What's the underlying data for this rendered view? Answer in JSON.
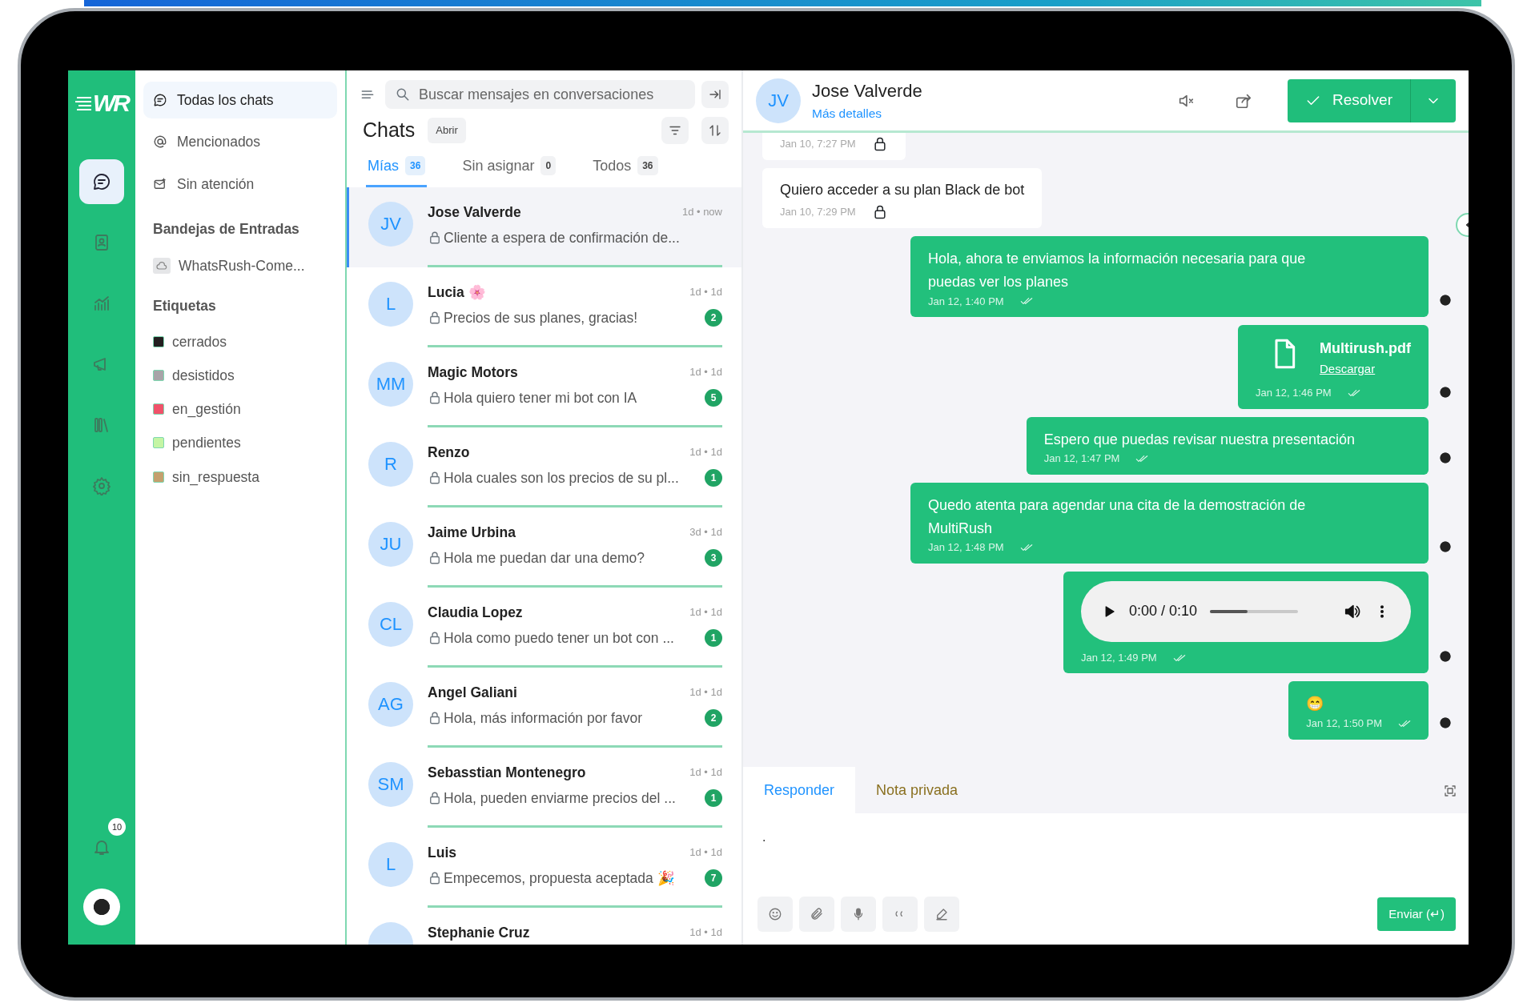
{
  "rail": {
    "logo_text": "WR",
    "items": [
      {
        "selected": true
      },
      {
        "selected": false
      },
      {
        "selected": false
      },
      {
        "selected": false
      },
      {
        "selected": false
      },
      {
        "selected": false
      }
    ],
    "notifications": "10"
  },
  "sidebar": {
    "nav": [
      {
        "label": "Todas los chats",
        "selected": true
      },
      {
        "label": "Mencionados",
        "selected": false
      },
      {
        "label": "Sin atención",
        "selected": false
      }
    ],
    "inboxes_title": "Bandejas de Entradas",
    "inboxes": [
      {
        "label": "WhatsRush-Come..."
      }
    ],
    "labels_title": "Etiquetas",
    "labels": [
      {
        "label": "cerrados",
        "color": "#231f20"
      },
      {
        "label": "desistidos",
        "color": "#a8a4a8"
      },
      {
        "label": "en_gestión",
        "color": "#f0526a"
      },
      {
        "label": "pendientes",
        "color": "#c4f5a4"
      },
      {
        "label": "sin_respuesta",
        "color": "#c4a06e"
      }
    ]
  },
  "chat_list": {
    "search": {
      "placeholder": "Buscar mensajes en conversaciones"
    },
    "title": "Chats",
    "status": "Abrir",
    "tabs": [
      {
        "label": "Mías",
        "count": "36",
        "selected": true
      },
      {
        "label": "Sin asignar",
        "count": "0",
        "selected": false
      },
      {
        "label": "Todos",
        "count": "36",
        "selected": false
      }
    ],
    "conversations": [
      {
        "initials": "JV",
        "name": "Jose Valverde",
        "time": "1d • now",
        "preview": "Cliente a espera de confirmación de...",
        "selected": true
      },
      {
        "initials": "L",
        "name": "Lucia 🌸",
        "time": "1d • 1d",
        "preview": "Precios de sus planes, gracias!",
        "unread": "2",
        "selected": false
      },
      {
        "initials": "MM",
        "name": "Magic Motors",
        "time": "1d • 1d",
        "preview": "Hola quiero tener mi bot con IA",
        "unread": "5",
        "selected": false
      },
      {
        "initials": "R",
        "name": "Renzo",
        "time": "1d • 1d",
        "preview": "Hola cuales son los precios de su pl...",
        "unread": "1",
        "selected": false
      },
      {
        "initials": "JU",
        "name": "Jaime Urbina",
        "time": "3d • 1d",
        "preview": "Hola me puedan dar una demo?",
        "unread": "3",
        "selected": false
      },
      {
        "initials": "CL",
        "name": "Claudia Lopez",
        "time": "1d • 1d",
        "preview": "Hola como puedo tener un bot con ...",
        "unread": "1",
        "selected": false
      },
      {
        "initials": "AG",
        "name": "Angel Galiani",
        "time": "1d • 1d",
        "preview": "Hola, más información por favor",
        "unread": "2",
        "selected": false
      },
      {
        "initials": "SM",
        "name": "Sebasstian Montenegro",
        "time": "1d • 1d",
        "preview": "Hola, pueden enviarme precios del ...",
        "unread": "1",
        "selected": false
      },
      {
        "initials": "L",
        "name": "Luis",
        "time": "1d • 1d",
        "preview": "Empecemos, propuesta aceptada 🎉",
        "unread": "7",
        "selected": false
      },
      {
        "name": "Stephanie Cruz",
        "time": "1d • 1d",
        "selected": false
      }
    ]
  },
  "conversation": {
    "initials": "JV",
    "name": "Jose Valverde",
    "details_link": "Más detalles",
    "resolve": "Resolver",
    "messages": [
      {
        "kind": "incoming",
        "time": "Jan 10, 7:27 PM"
      },
      {
        "kind": "incoming",
        "text": "Quiero acceder a su plan Black de bot",
        "time": "Jan 10, 7:29 PM"
      },
      {
        "kind": "outgoing",
        "text": "Hola, ahora te enviamos la información necesaria para que puedas ver los planes",
        "time": "Jan 12, 1:40 PM"
      },
      {
        "kind": "file",
        "file_name": "Multirush.pdf",
        "link": "Descargar",
        "time": "Jan 12, 1:46 PM"
      },
      {
        "kind": "outgoing",
        "text": "Espero que puedas revisar nuestra presentación",
        "time": "Jan 12, 1:47 PM"
      },
      {
        "kind": "outgoing",
        "text": "Quedo atenta para agendar una cita de la demostración de MultiRush",
        "time": "Jan 12, 1:48 PM"
      },
      {
        "kind": "audio",
        "duration": "0:00 / 0:10",
        "level": 0.43,
        "time": "Jan 12, 1:49 PM"
      },
      {
        "kind": "outgoing",
        "text": "😁",
        "time": "Jan 12, 1:50 PM"
      }
    ],
    "composer": {
      "tabs": [
        {
          "label": "Responder",
          "selected": true
        },
        {
          "label": "Nota privada",
          "selected": false
        }
      ],
      "value": ".",
      "send": "Enviar (↵)"
    }
  }
}
